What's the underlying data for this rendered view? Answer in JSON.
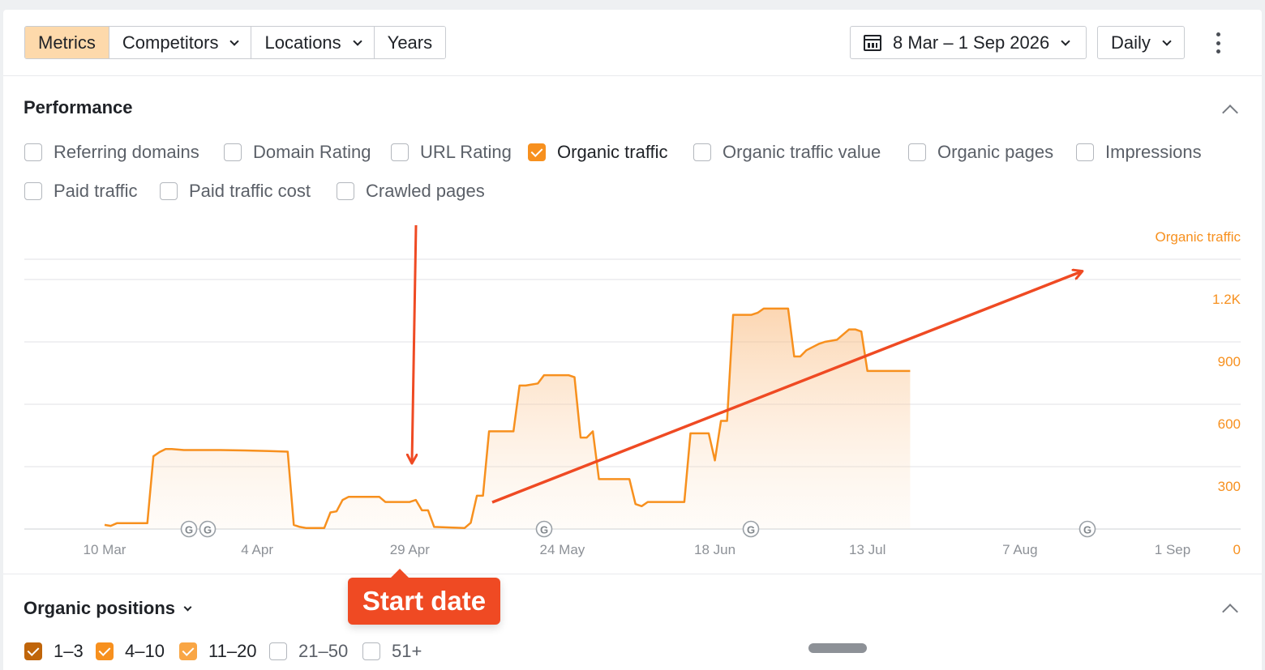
{
  "toolbar": {
    "tabs": [
      {
        "label": "Metrics",
        "active": true,
        "dropdown": false
      },
      {
        "label": "Competitors",
        "active": false,
        "dropdown": true
      },
      {
        "label": "Locations",
        "active": false,
        "dropdown": true
      },
      {
        "label": "Years",
        "active": false,
        "dropdown": false
      }
    ],
    "date_range": "8 Mar – 1 Sep 2026",
    "granularity": "Daily"
  },
  "performance": {
    "title": "Performance",
    "metrics": [
      {
        "label": "Referring domains",
        "checked": false
      },
      {
        "label": "Domain Rating",
        "checked": false
      },
      {
        "label": "URL Rating",
        "checked": false
      },
      {
        "label": "Organic traffic",
        "checked": true
      },
      {
        "label": "Organic traffic value",
        "checked": false
      },
      {
        "label": "Organic pages",
        "checked": false
      },
      {
        "label": "Impressions",
        "checked": false
      },
      {
        "label": "Paid traffic",
        "checked": false
      },
      {
        "label": "Paid traffic cost",
        "checked": false
      },
      {
        "label": "Crawled pages",
        "checked": false
      }
    ]
  },
  "chart_data": {
    "type": "area",
    "series": [
      {
        "name": "Organic traffic",
        "color": "#f7901e",
        "points": [
          [
            "2026-03-10",
            20
          ],
          [
            "2026-03-11",
            15
          ],
          [
            "2026-03-12",
            28
          ],
          [
            "2026-03-13",
            28
          ],
          [
            "2026-03-14",
            28
          ],
          [
            "2026-03-17",
            28
          ],
          [
            "2026-03-18",
            350
          ],
          [
            "2026-03-19",
            370
          ],
          [
            "2026-03-20",
            385
          ],
          [
            "2026-03-21",
            385
          ],
          [
            "2026-03-23",
            380
          ],
          [
            "2026-03-29",
            380
          ],
          [
            "2026-04-02",
            378
          ],
          [
            "2026-04-06",
            375
          ],
          [
            "2026-04-09",
            372
          ],
          [
            "2026-04-10",
            20
          ],
          [
            "2026-04-11",
            10
          ],
          [
            "2026-04-12",
            5
          ],
          [
            "2026-04-15",
            5
          ],
          [
            "2026-04-16",
            80
          ],
          [
            "2026-04-17",
            85
          ],
          [
            "2026-04-18",
            140
          ],
          [
            "2026-04-19",
            155
          ],
          [
            "2026-04-20",
            155
          ],
          [
            "2026-04-24",
            155
          ],
          [
            "2026-04-25",
            130
          ],
          [
            "2026-04-29",
            130
          ],
          [
            "2026-04-30",
            140
          ],
          [
            "2026-05-01",
            90
          ],
          [
            "2026-05-02",
            90
          ],
          [
            "2026-05-03",
            10
          ],
          [
            "2026-05-08",
            5
          ],
          [
            "2026-05-09",
            30
          ],
          [
            "2026-05-10",
            160
          ],
          [
            "2026-05-11",
            160
          ],
          [
            "2026-05-12",
            470
          ],
          [
            "2026-05-16",
            470
          ],
          [
            "2026-05-17",
            690
          ],
          [
            "2026-05-18",
            690
          ],
          [
            "2026-05-20",
            700
          ],
          [
            "2026-05-21",
            740
          ],
          [
            "2026-05-25",
            740
          ],
          [
            "2026-05-26",
            730
          ],
          [
            "2026-05-27",
            440
          ],
          [
            "2026-05-28",
            440
          ],
          [
            "2026-05-29",
            470
          ],
          [
            "2026-05-30",
            240
          ],
          [
            "2026-06-04",
            240
          ],
          [
            "2026-06-05",
            120
          ],
          [
            "2026-06-06",
            110
          ],
          [
            "2026-06-07",
            130
          ],
          [
            "2026-06-13",
            130
          ],
          [
            "2026-06-14",
            460
          ],
          [
            "2026-06-17",
            460
          ],
          [
            "2026-06-18",
            330
          ],
          [
            "2026-06-19",
            520
          ],
          [
            "2026-06-20",
            520
          ],
          [
            "2026-06-21",
            1030
          ],
          [
            "2026-06-24",
            1030
          ],
          [
            "2026-06-25",
            1040
          ],
          [
            "2026-06-26",
            1060
          ],
          [
            "2026-06-27",
            1060
          ],
          [
            "2026-06-30",
            1060
          ],
          [
            "2026-07-01",
            830
          ],
          [
            "2026-07-02",
            830
          ],
          [
            "2026-07-03",
            860
          ],
          [
            "2026-07-05",
            890
          ],
          [
            "2026-07-06",
            900
          ],
          [
            "2026-07-08",
            910
          ],
          [
            "2026-07-10",
            960
          ],
          [
            "2026-07-11",
            960
          ],
          [
            "2026-07-12",
            950
          ],
          [
            "2026-07-13",
            760
          ],
          [
            "2026-07-14",
            760
          ],
          [
            "2026-07-20",
            760
          ]
        ]
      }
    ],
    "x_ticks": [
      "10 Mar",
      "4 Apr",
      "29 Apr",
      "24 May",
      "18 Jun",
      "13 Jul",
      "7 Aug",
      "1 Sep"
    ],
    "y_ticks": [
      "0",
      "300",
      "600",
      "900",
      "1.2K"
    ],
    "ylim": [
      0,
      1200
    ],
    "y_axis_title": "Organic traffic",
    "y_axis_side": "right",
    "grid": true,
    "event_marker_icon": "google-update-icon",
    "event_marker_count": 5
  },
  "annotations": {
    "callout_label": "Start date",
    "arrow_color": "#ef4a23"
  },
  "positions": {
    "title": "Organic positions",
    "ranges": [
      {
        "label": "1–3",
        "checked": true,
        "style": "dark"
      },
      {
        "label": "4–10",
        "checked": true,
        "style": "on"
      },
      {
        "label": "11–20",
        "checked": true,
        "style": "light"
      },
      {
        "label": "21–50",
        "checked": false,
        "style": ""
      },
      {
        "label": "51+",
        "checked": false,
        "style": ""
      }
    ]
  }
}
